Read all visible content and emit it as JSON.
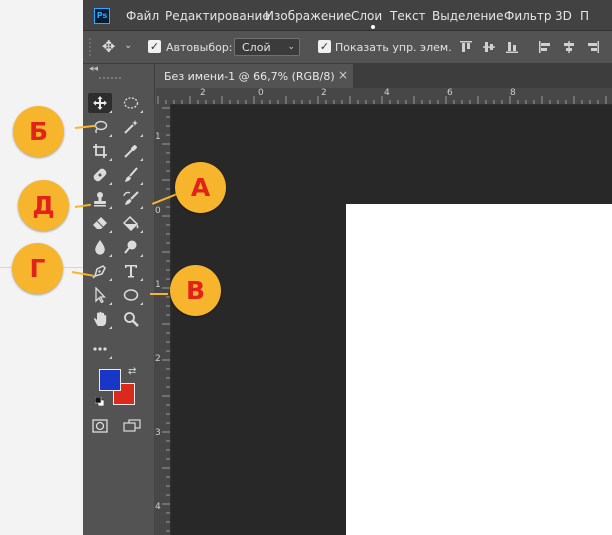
{
  "app": {
    "logo": "Ps",
    "menu": [
      "Файл",
      "Редактирование",
      "Изображение",
      "Слои",
      "Текст",
      "Выделение",
      "Фильтр",
      "3D",
      "П"
    ]
  },
  "options": {
    "move_icon": "move-icon",
    "auto_select_label": "Автовыбор:",
    "auto_select_value": "Слой",
    "show_transform_label": "Показать упр. элем.",
    "auto_select_checked": true,
    "show_transform_checked": true
  },
  "document": {
    "tab_title": "Без имени-1 @ 66,7% (RGB/8)",
    "close_glyph": "×"
  },
  "rulers": {
    "top": [
      "2",
      "0",
      "2",
      "4",
      "6",
      "8"
    ],
    "left": [
      "1",
      "0",
      "1",
      "2",
      "3",
      "4"
    ]
  },
  "toolbar": {
    "tools": [
      {
        "icon": "move-tool-icon",
        "col": 0,
        "row": 0,
        "active": true
      },
      {
        "icon": "elliptical-marquee-icon",
        "col": 1,
        "row": 0
      },
      {
        "icon": "lasso-icon",
        "col": 0,
        "row": 1
      },
      {
        "icon": "magic-wand-icon",
        "col": 1,
        "row": 1
      },
      {
        "icon": "crop-icon",
        "col": 0,
        "row": 2
      },
      {
        "icon": "eyedropper-icon",
        "col": 1,
        "row": 2
      },
      {
        "icon": "healing-brush-icon",
        "col": 0,
        "row": 3
      },
      {
        "icon": "brush-icon",
        "col": 1,
        "row": 3
      },
      {
        "icon": "clone-stamp-icon",
        "col": 0,
        "row": 4
      },
      {
        "icon": "history-brush-icon",
        "col": 1,
        "row": 4
      },
      {
        "icon": "eraser-icon",
        "col": 0,
        "row": 5
      },
      {
        "icon": "paint-bucket-icon",
        "col": 1,
        "row": 5
      },
      {
        "icon": "blur-icon",
        "col": 0,
        "row": 6
      },
      {
        "icon": "dodge-icon",
        "col": 1,
        "row": 6
      },
      {
        "icon": "pen-icon",
        "col": 0,
        "row": 7
      },
      {
        "icon": "type-icon",
        "col": 1,
        "row": 7
      },
      {
        "icon": "path-selection-icon",
        "col": 0,
        "row": 8
      },
      {
        "icon": "ellipse-shape-icon",
        "col": 1,
        "row": 8
      },
      {
        "icon": "hand-icon",
        "col": 0,
        "row": 9
      },
      {
        "icon": "zoom-icon",
        "col": 1,
        "row": 9
      },
      {
        "icon": "more-tools-icon",
        "col": 0,
        "row": 10
      }
    ],
    "foreground_color": "#1a36c9",
    "background_color": "#d92a1c"
  },
  "annotations": [
    {
      "label": "Б",
      "target": "lasso-icon"
    },
    {
      "label": "А",
      "target": "history-brush-icon"
    },
    {
      "label": "Д",
      "target": "clone-stamp-icon"
    },
    {
      "label": "Г",
      "target": "pen-icon"
    },
    {
      "label": "В",
      "target": "ellipse-shape-icon"
    }
  ],
  "colors": {
    "badge": "#f6b52d",
    "badge_text": "#e2231a",
    "panel": "#535353",
    "canvas": "#282828"
  }
}
